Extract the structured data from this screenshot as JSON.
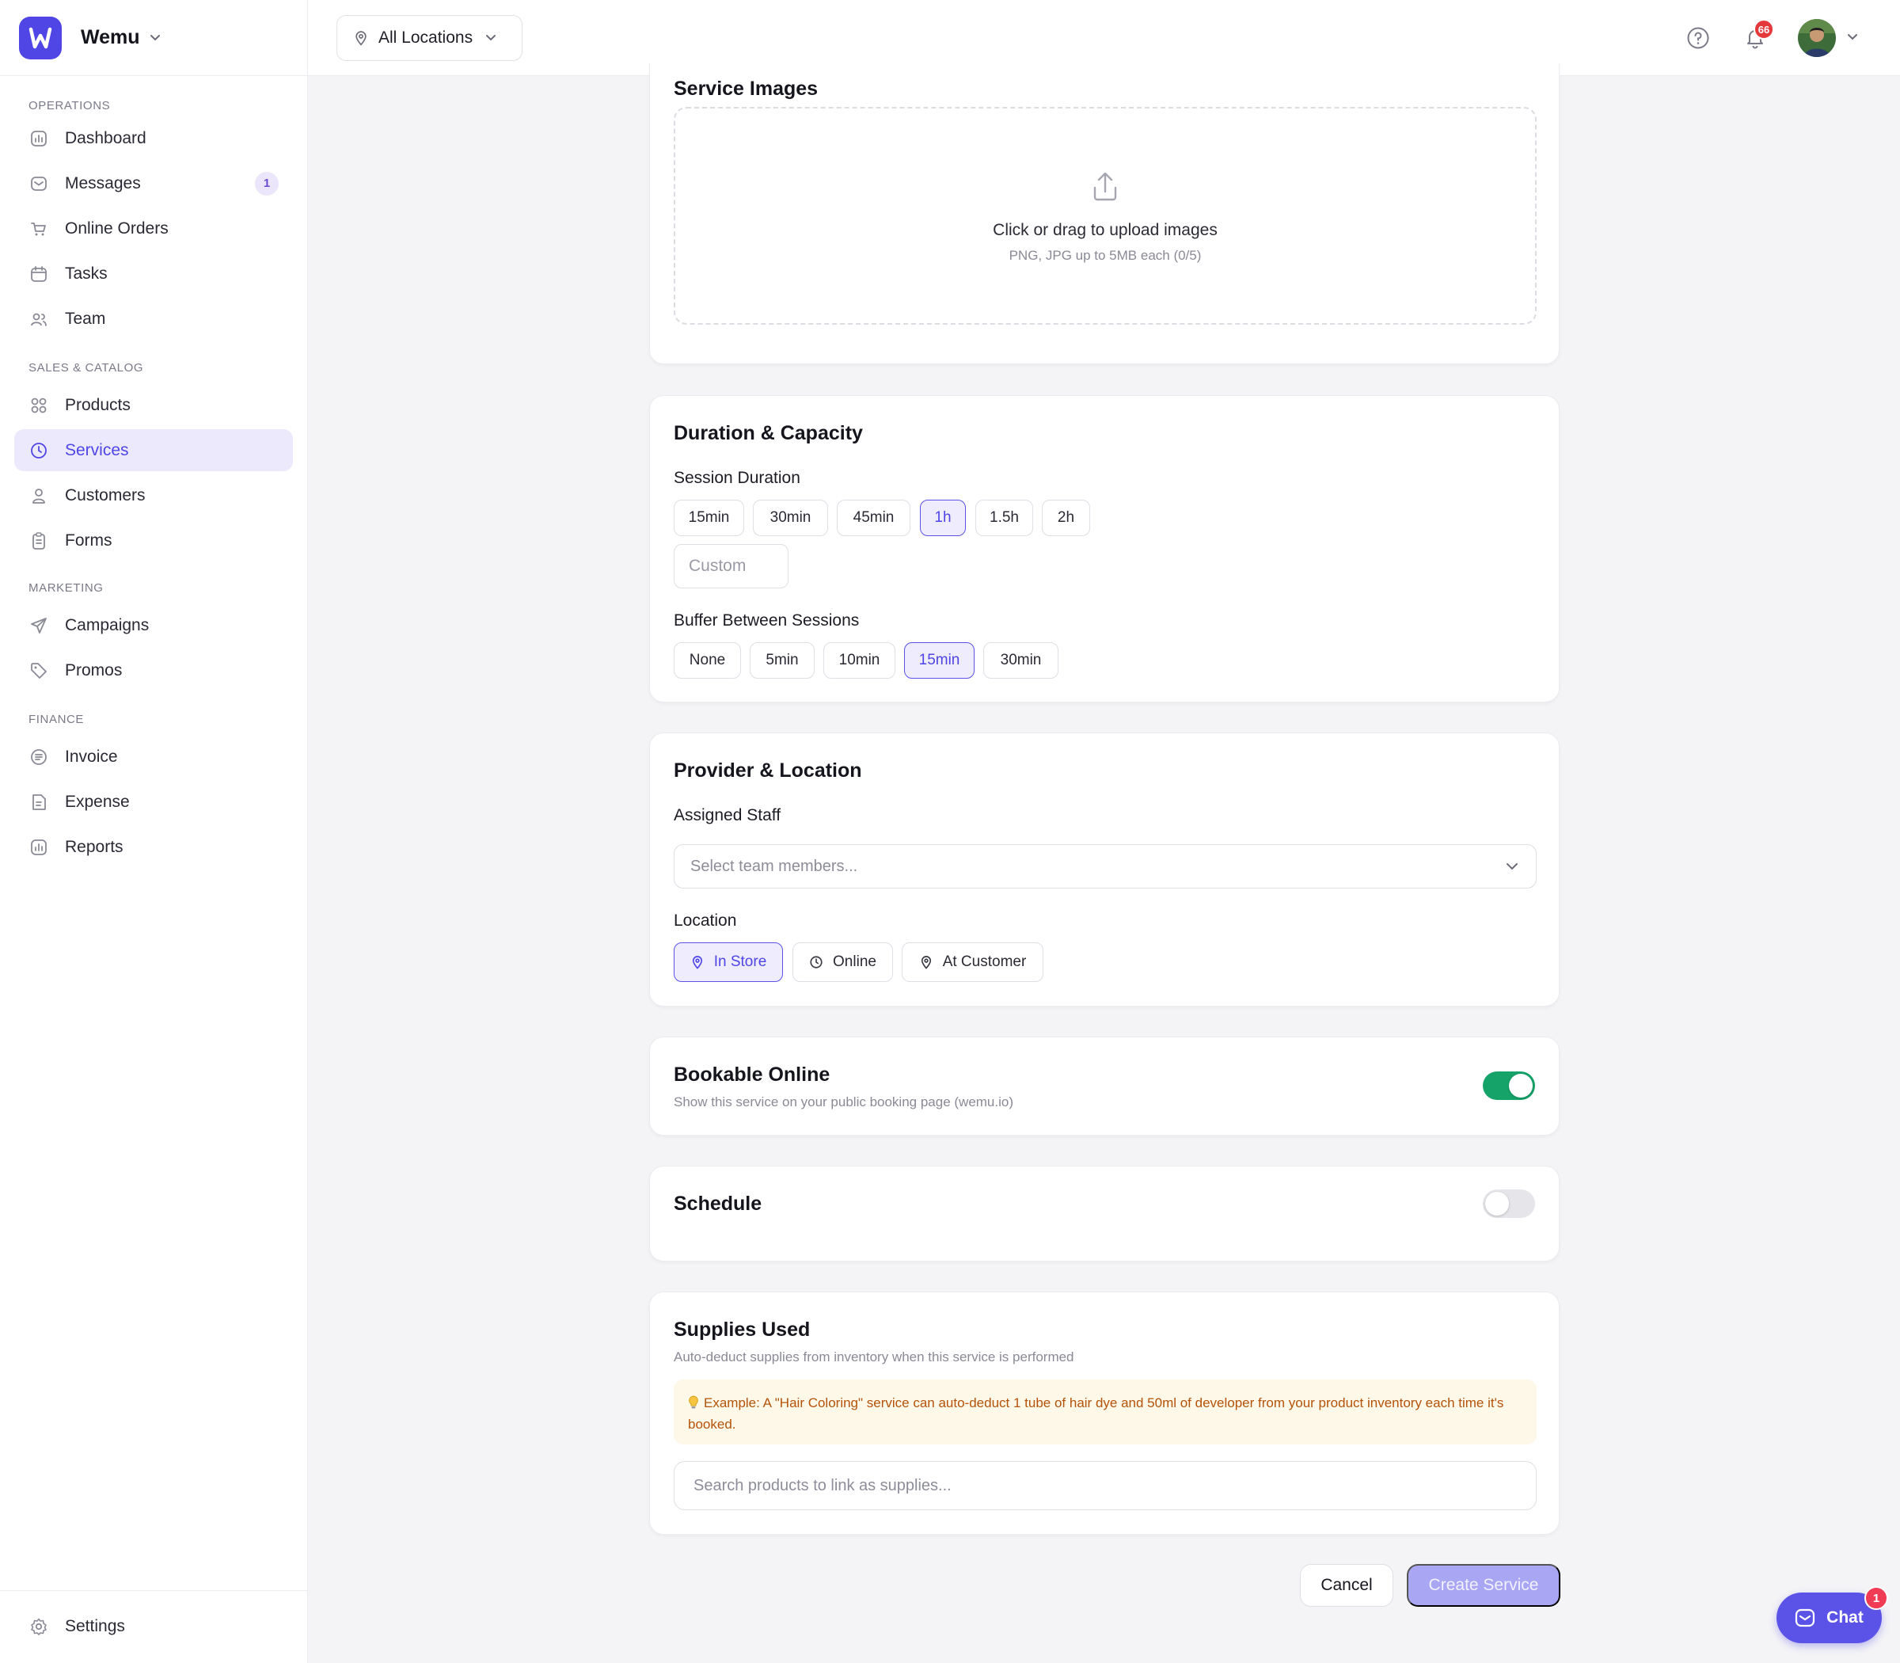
{
  "brand": {
    "name": "Wemu"
  },
  "sidebar": {
    "sections": [
      {
        "label": "OPERATIONS",
        "items": [
          {
            "label": "Dashboard",
            "icon": "chart-icon"
          },
          {
            "label": "Messages",
            "icon": "mail-icon",
            "badge": "1"
          },
          {
            "label": "Online Orders",
            "icon": "cart-icon"
          },
          {
            "label": "Tasks",
            "icon": "calendar-icon"
          },
          {
            "label": "Team",
            "icon": "users-icon"
          }
        ]
      },
      {
        "label": "SALES & CATALOG",
        "items": [
          {
            "label": "Products",
            "icon": "grid-icon"
          },
          {
            "label": "Services",
            "icon": "clock-icon",
            "active": true
          },
          {
            "label": "Customers",
            "icon": "user-icon"
          },
          {
            "label": "Forms",
            "icon": "clipboard-icon"
          }
        ]
      },
      {
        "label": "MARKETING",
        "items": [
          {
            "label": "Campaigns",
            "icon": "send-icon"
          },
          {
            "label": "Promos",
            "icon": "tag-icon"
          }
        ]
      },
      {
        "label": "FINANCE",
        "items": [
          {
            "label": "Invoice",
            "icon": "invoice-icon"
          },
          {
            "label": "Expense",
            "icon": "receipt-icon"
          },
          {
            "label": "Reports",
            "icon": "chart-icon"
          }
        ]
      }
    ],
    "settings_label": "Settings"
  },
  "topbar": {
    "location_label": "All Locations",
    "notification_count": "66"
  },
  "service_images": {
    "title": "Service Images",
    "upload_title": "Click or drag to upload images",
    "upload_sub": "PNG, JPG up to 5MB each (0/5)"
  },
  "duration": {
    "title": "Duration & Capacity",
    "session_label": "Session Duration",
    "session_options": [
      "15min",
      "30min",
      "45min",
      "1h",
      "1.5h",
      "2h"
    ],
    "session_selected": "1h",
    "custom_placeholder": "Custom",
    "buffer_label": "Buffer Between Sessions",
    "buffer_options": [
      "None",
      "5min",
      "10min",
      "15min",
      "30min"
    ],
    "buffer_selected": "15min"
  },
  "provider": {
    "title": "Provider & Location",
    "staff_label": "Assigned Staff",
    "staff_placeholder": "Select team members...",
    "location_label": "Location",
    "location_options": [
      "In Store",
      "Online",
      "At Customer"
    ],
    "location_selected": "In Store"
  },
  "bookable": {
    "title": "Bookable Online",
    "subtitle": "Show this service on your public booking page (wemu.io)",
    "enabled": true
  },
  "schedule": {
    "title": "Schedule",
    "enabled": false
  },
  "supplies": {
    "title": "Supplies Used",
    "subtitle": "Auto-deduct supplies from inventory when this service is performed",
    "tip": "Example: A \"Hair Coloring\" service can auto-deduct 1 tube of hair dye and 50ml of developer from your product inventory each time it's booked.",
    "search_placeholder": "Search products to link as supplies..."
  },
  "actions": {
    "cancel_label": "Cancel",
    "create_label": "Create Service"
  },
  "chat": {
    "label": "Chat",
    "badge": "1"
  },
  "colors": {
    "accent": "#4f46e5",
    "toggle_on": "#16a36a",
    "badge_red": "#e5383b",
    "tip_text": "#b45309"
  }
}
